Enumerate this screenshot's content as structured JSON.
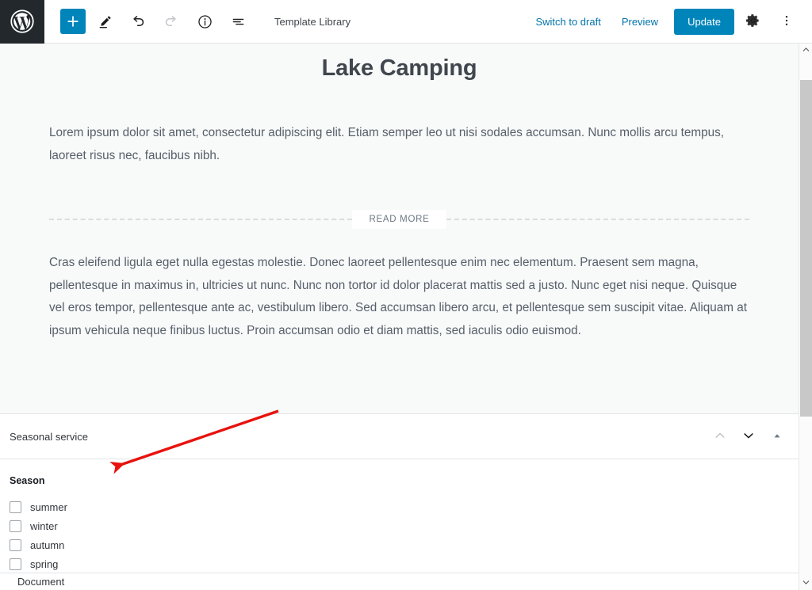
{
  "toolbar": {
    "logo_icon": "wordpress-logo-icon",
    "add_block_label": "+",
    "add_block_icon": "plus-icon",
    "edit_icon": "pencil-icon",
    "undo_icon": "undo-arrow-icon",
    "redo_icon": "redo-arrow-icon",
    "info_icon": "info-circle-icon",
    "outline_icon": "content-structure-icon",
    "template_label": "Template Library",
    "switch_to_draft_label": "Switch to draft",
    "preview_label": "Preview",
    "update_label": "Update",
    "settings_icon": "gear-icon",
    "more_menu_icon": "vertical-ellipsis-icon",
    "accent_color": "#0085ba",
    "link_color": "#0073aa",
    "logo_bg": "#23282d"
  },
  "editor": {
    "post_title": "Lake Camping",
    "paragraph_1": "Lorem ipsum dolor sit amet, consectetur adipiscing elit. Etiam semper leo ut nisi sodales accumsan. Nunc mollis arcu tempus, laoreet risus nec, faucibus nibh.",
    "read_more_label": "READ MORE",
    "paragraph_2": "Cras eleifend ligula eget nulla egestas molestie. Donec laoreet pellentesque enim nec elementum. Praesent sem magna, pellentesque in maximus in, ultricies ut nunc. Nunc non tortor id dolor placerat mattis sed a justo. Nunc eget nisi neque. Quisque vel eros tempor, pellentesque ante ac, vestibulum libero. Sed accumsan libero arcu, et pellentesque sem suscipit vitae. Aliquam at ipsum vehicula neque finibus luctus. Proin accumsan odio et diam mattis, sed iaculis odio euismod.",
    "canvas_bg": "#f8f9f9",
    "title_color": "#40464d",
    "text_color": "#57606a"
  },
  "seasonal_panel": {
    "title": "Seasonal service",
    "move_up_icon": "chevron-up-icon",
    "move_down_icon": "chevron-down-icon",
    "collapse_icon": "triangle-up-icon",
    "section_heading": "Season",
    "checkboxes": [
      {
        "label": "summer",
        "checked": false
      },
      {
        "label": "winter",
        "checked": false
      },
      {
        "label": "autumn",
        "checked": false
      },
      {
        "label": "spring",
        "checked": false
      }
    ]
  },
  "document_panel": {
    "label": "Document"
  },
  "scrollbar": {
    "up_arrow_icon": "scroll-up-arrow-icon",
    "down_arrow_icon": "scroll-down-arrow-icon",
    "thumb_color": "#c8c8c8"
  },
  "annotation": {
    "arrow_color": "#e8120e",
    "arrow_name": "red-pointer-arrow"
  }
}
